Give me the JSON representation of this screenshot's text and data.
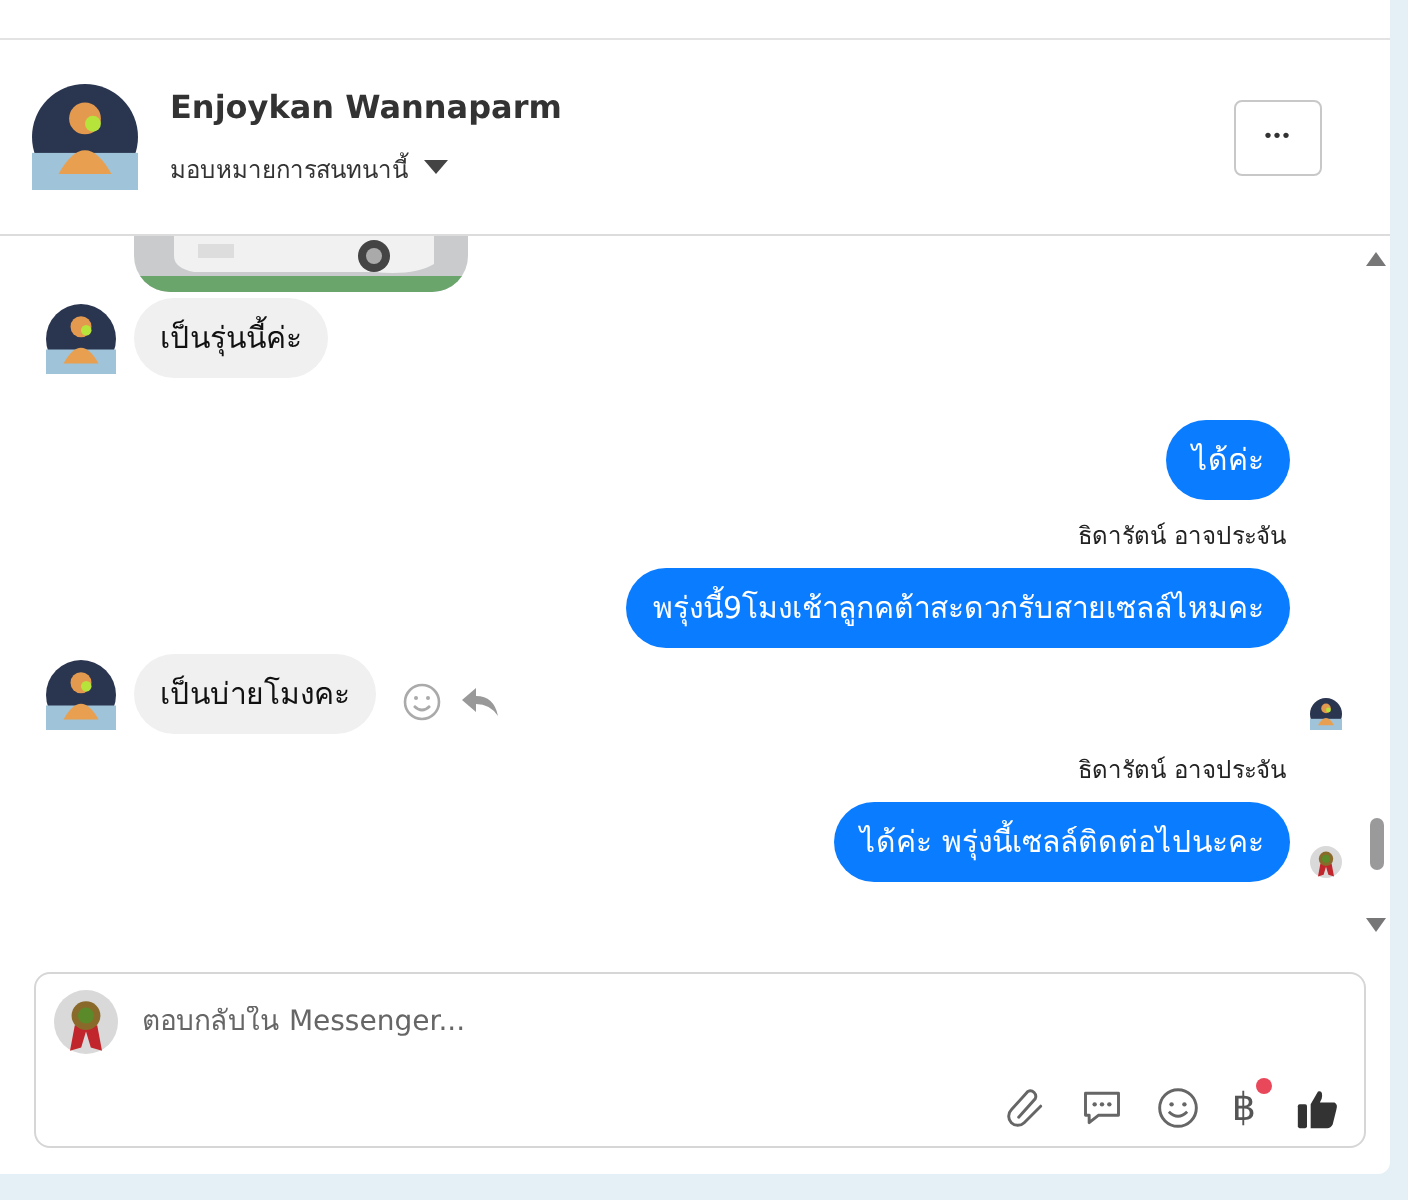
{
  "header": {
    "name": "Enjoykan Wannaparm",
    "assign_label": "มอบหมายการสนทนานี้",
    "more_button": "•••"
  },
  "messages": [
    {
      "kind": "picture"
    },
    {
      "kind": "incoming",
      "text": "เป็นรุ่นนี้ค่ะ"
    },
    {
      "kind": "outgoing",
      "text": "ได้ค่ะ"
    },
    {
      "kind": "outgoing",
      "sender": "ธิดารัตน์ อาจประจัน",
      "text": "พรุ่งนี้9โมงเช้าลูกคต้าสะดวกรับสายเซลล์ไหมคะ"
    },
    {
      "kind": "incoming",
      "text": "เป็นบ่ายโมงคะ",
      "actions": true,
      "read": {
        "kind": "customer"
      }
    },
    {
      "kind": "outgoing",
      "sender": "ธิดารัตน์ อาจประจัน",
      "text": "ได้ค่ะ พรุ่งนี้เซลล์ติดต่อไปนะคะ",
      "read": {
        "kind": "page"
      }
    }
  ],
  "composer": {
    "placeholder": "ตอบกลับใน Messenger...",
    "currency_symbol": "฿",
    "currency_badge": true
  }
}
